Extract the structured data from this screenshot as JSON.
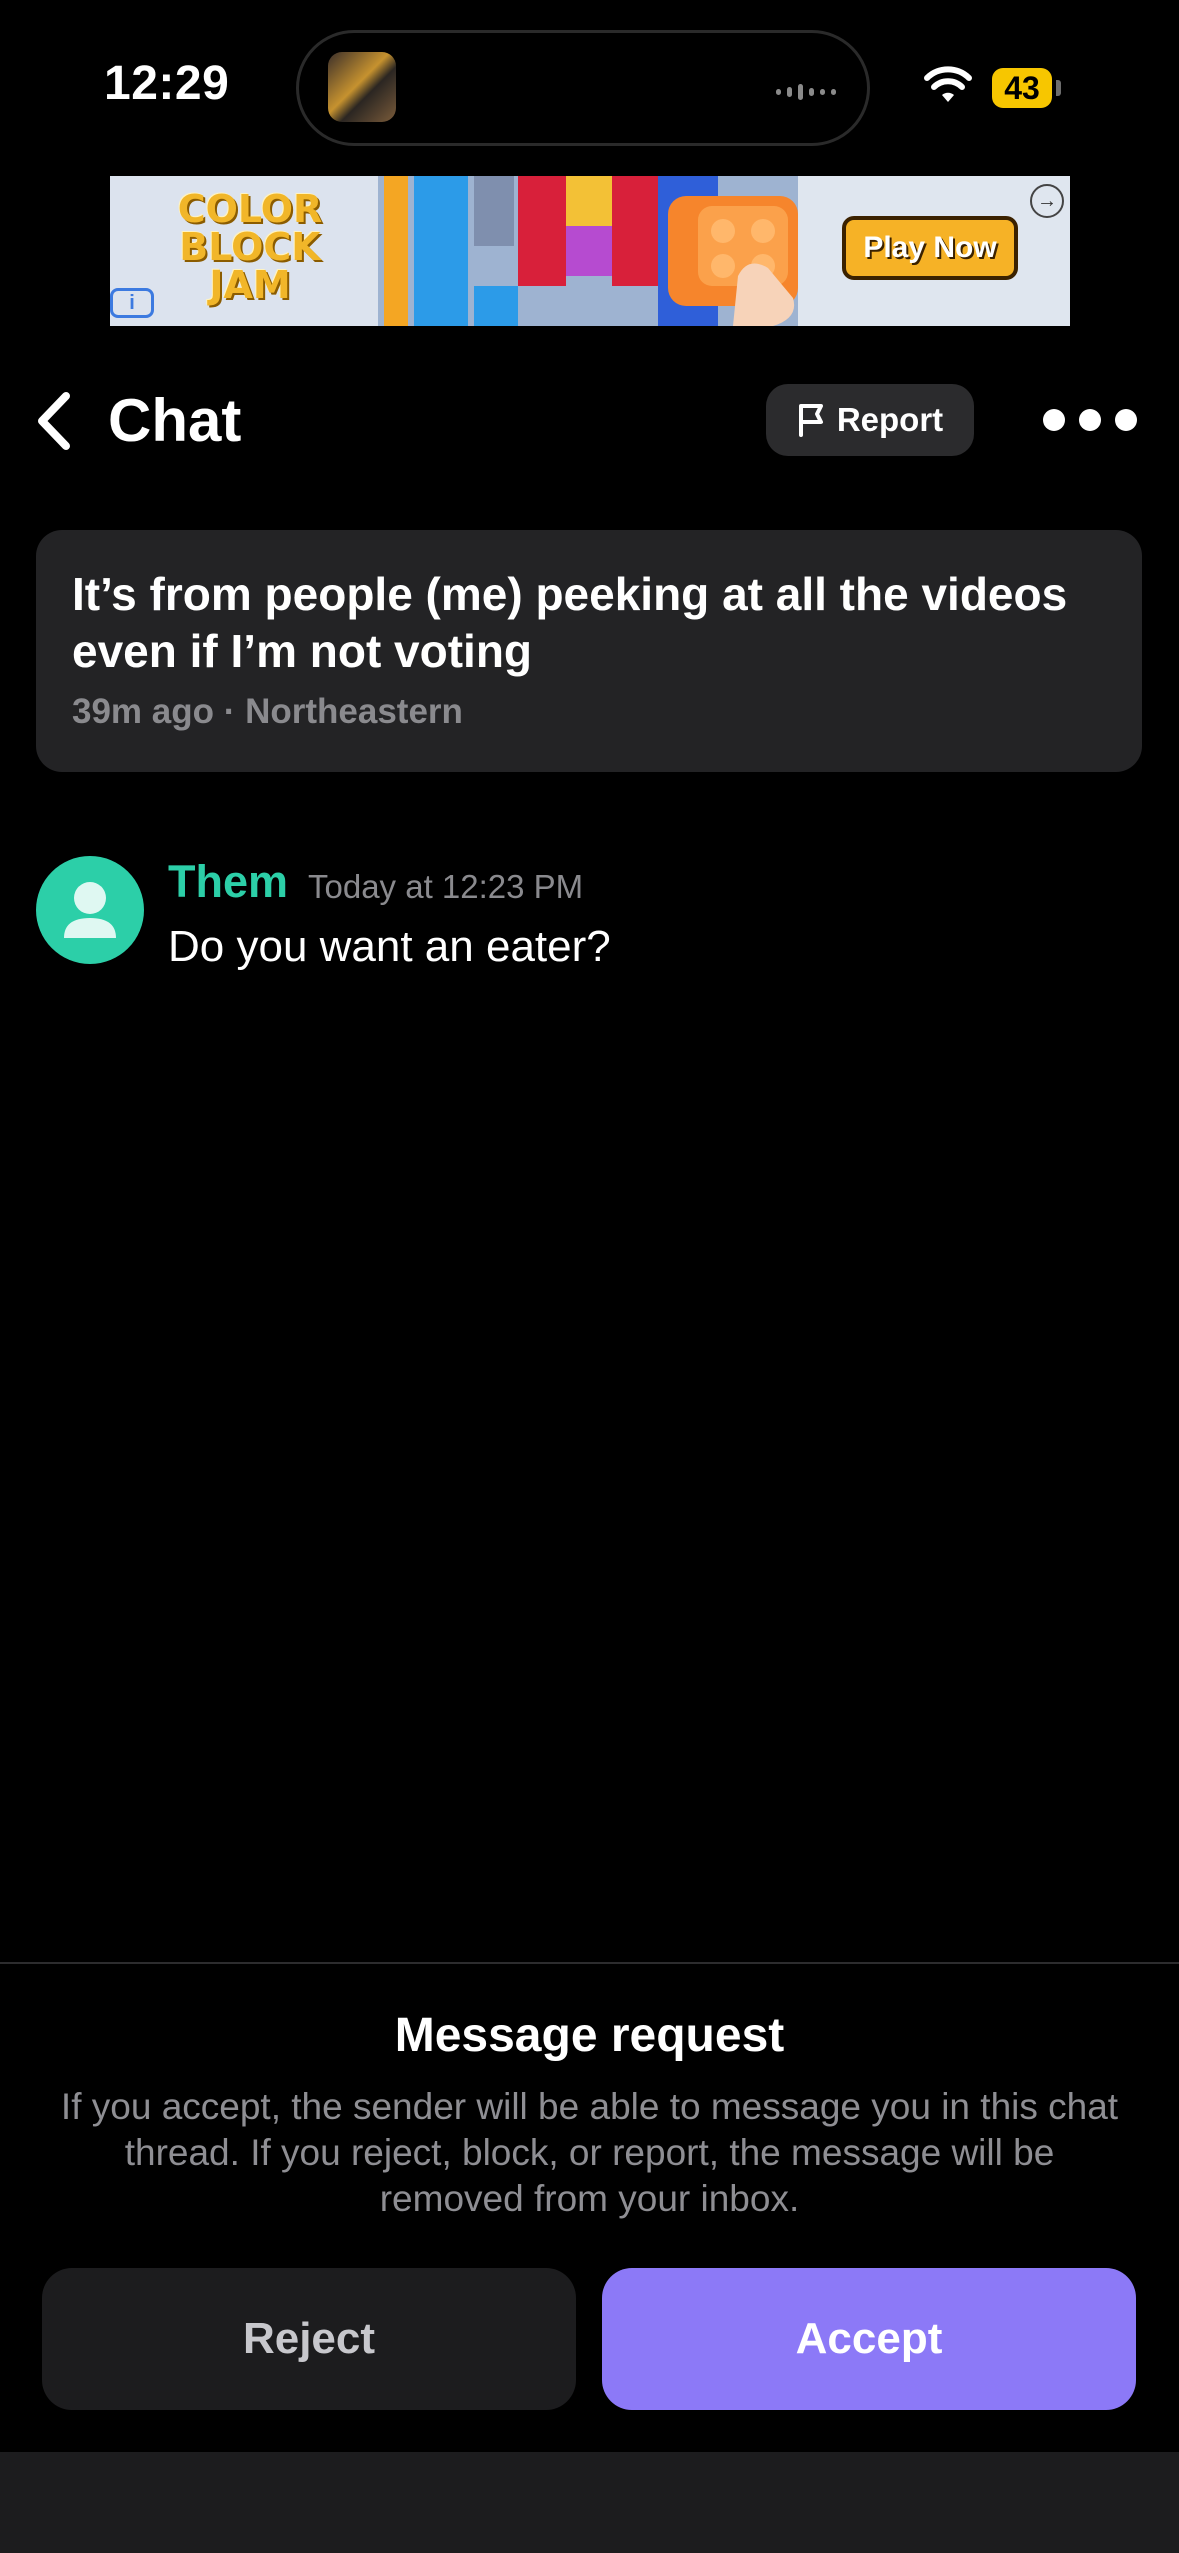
{
  "status_bar": {
    "time": "12:29",
    "battery": "43"
  },
  "ad": {
    "title": "COLOR BLOCK JAM",
    "cta": "Play Now",
    "info": "i",
    "close": "→"
  },
  "header": {
    "title": "Chat",
    "report_label": "Report"
  },
  "post": {
    "text": "It’s from people (me) peeking at all the videos even if I’m not voting",
    "meta": "39m ago · Northeastern"
  },
  "message": {
    "sender": "Them",
    "time": "Today at 12:23 PM",
    "text": "Do you want an eater?"
  },
  "request": {
    "title": "Message request",
    "description": "If you accept, the sender will be able to message you in this chat thread. If you reject, block, or report, the message will be removed from your inbox.",
    "reject_label": "Reject",
    "accept_label": "Accept"
  },
  "colors": {
    "accent_purple": "#8c79f7",
    "sender_green": "#2ccfa8",
    "battery_yellow": "#f7c600"
  }
}
